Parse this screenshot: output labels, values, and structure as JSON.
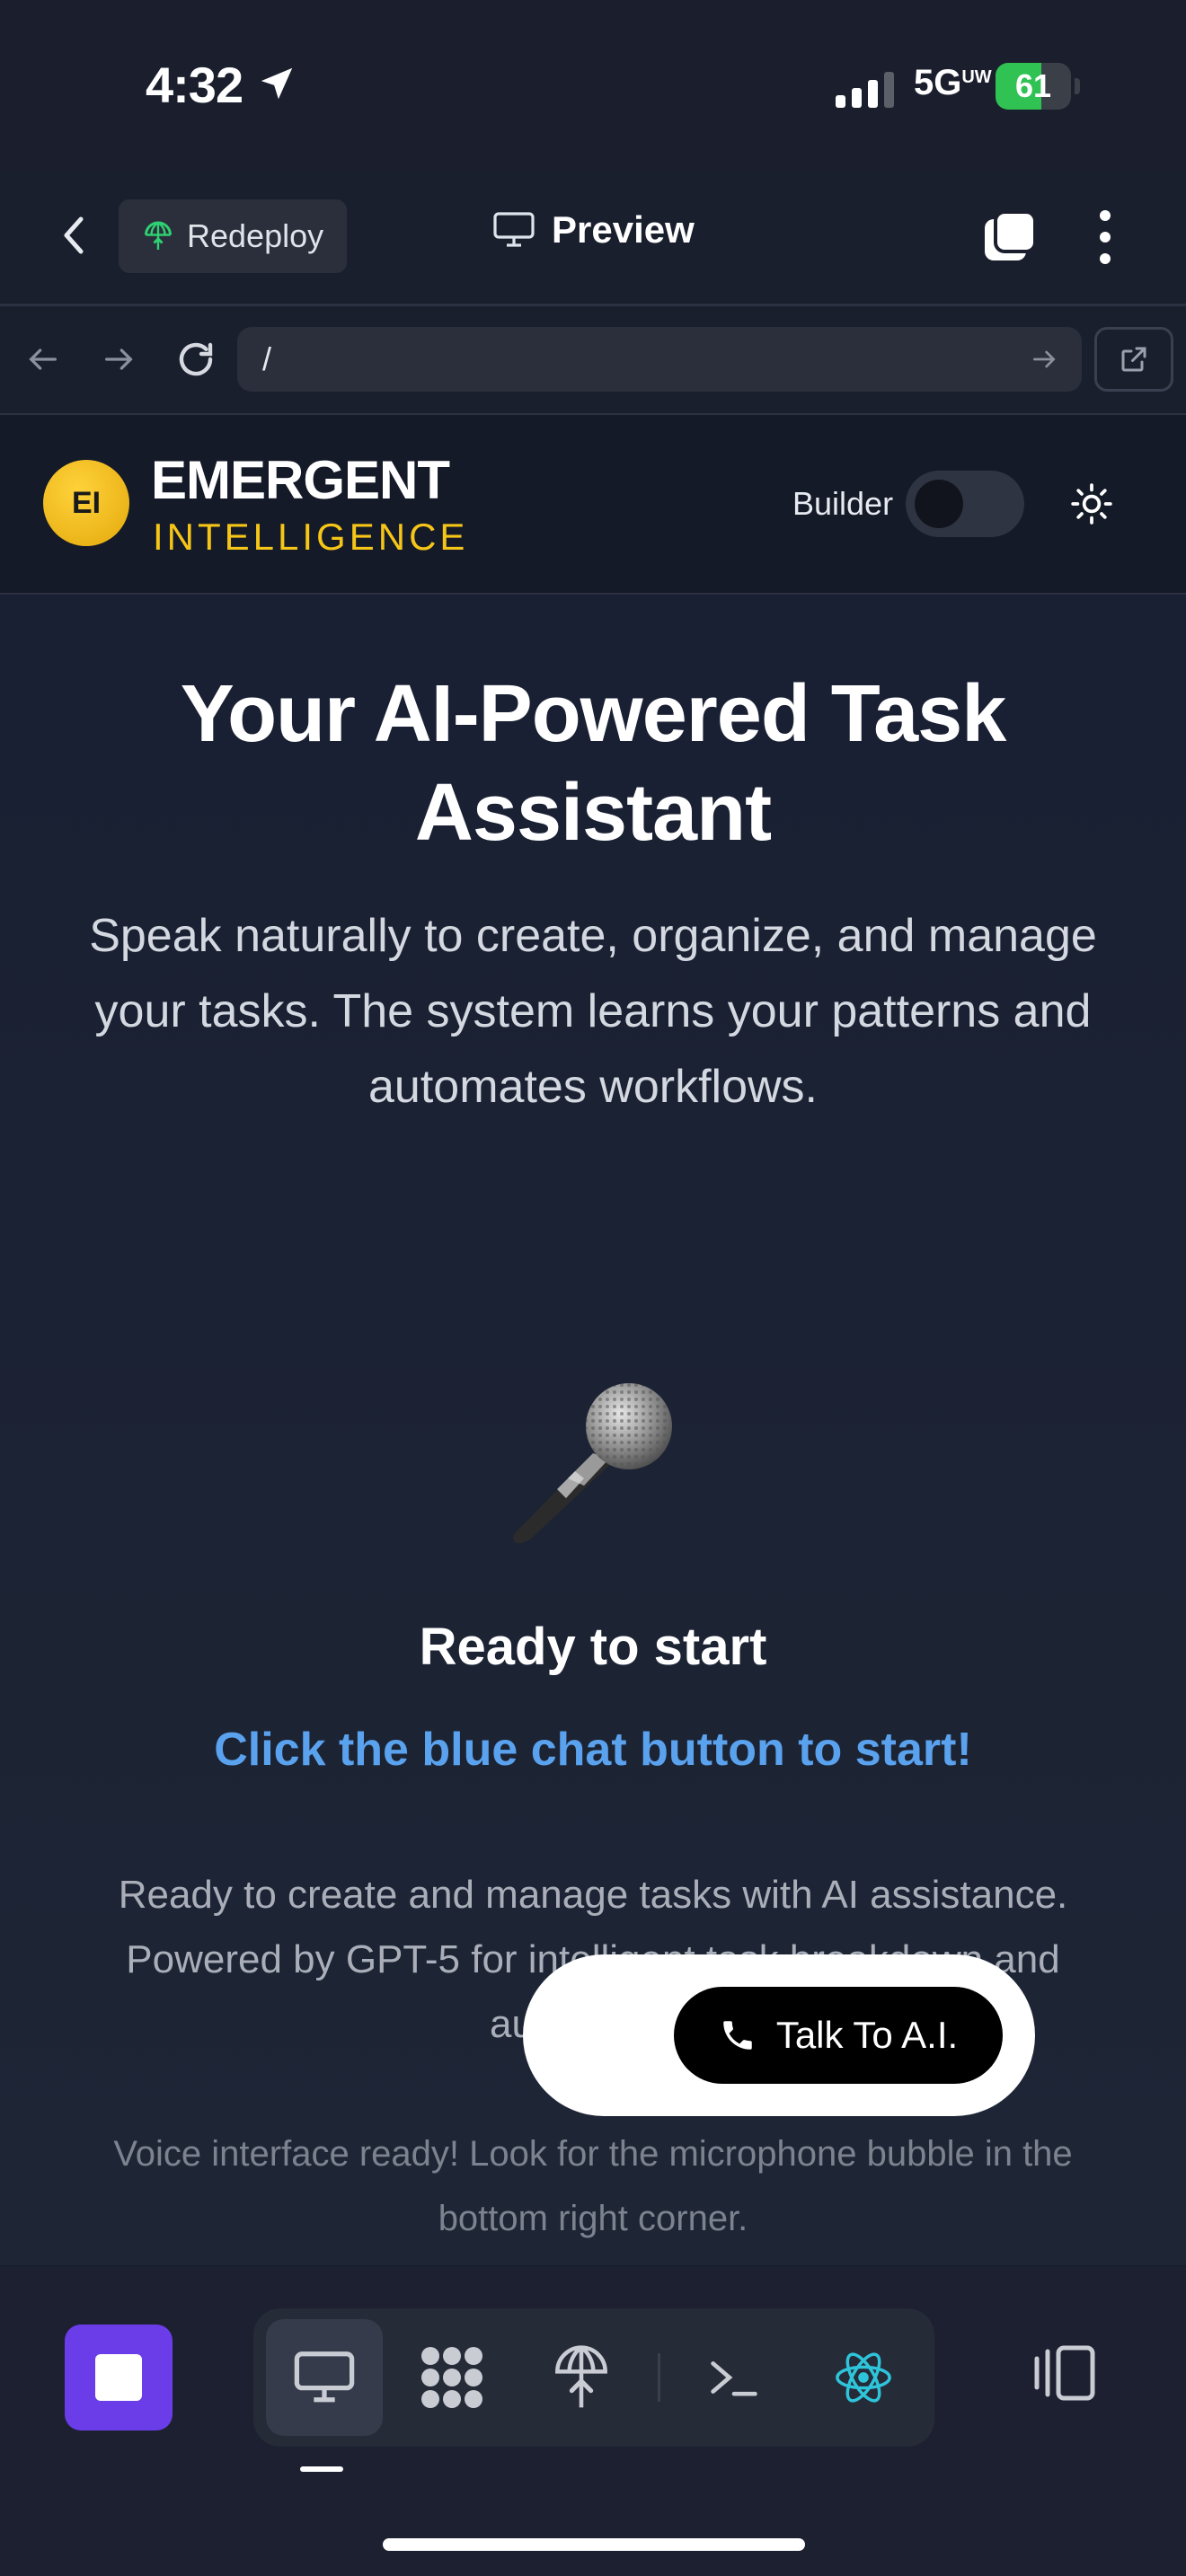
{
  "status_bar": {
    "time": "4:32",
    "network": "5G",
    "network_sup": "UW",
    "battery": "61",
    "battery_level": 0.61
  },
  "header": {
    "redeploy_label": "Redeploy",
    "preview_label": "Preview"
  },
  "browser": {
    "url": "/"
  },
  "site": {
    "logo_initials": "EI",
    "brand_name": "EMERGENT",
    "brand_sub": "INTELLIGENCE",
    "builder_label": "Builder",
    "builder_on": false
  },
  "main": {
    "title": "Your AI-Powered Task Assistant",
    "description": "Speak naturally to create, organize, and manage your tasks. The system learns your patterns and automates workflows.",
    "ready_title": "Ready to start",
    "cta": "Click the blue chat button to start!",
    "body": "Ready to create and manage tasks with AI assistance. Powered by GPT-5 for intelligent task breakdown and automation.",
    "voice_note": "Voice interface ready! Look for the microphone bubble in the bottom right corner."
  },
  "talk_widget": {
    "label": "Talk To A.I."
  },
  "colors": {
    "accent_yellow": "#f5c518",
    "cta_blue": "#5aa2ee",
    "stop_purple": "#6a3de8",
    "react_teal": "#2ec4d9"
  },
  "toolbar": {
    "tools": [
      {
        "icon": "monitor-icon"
      },
      {
        "icon": "grid-icon"
      },
      {
        "icon": "deploy-icon"
      },
      {
        "icon": "terminal-icon"
      },
      {
        "icon": "react-icon"
      }
    ]
  }
}
